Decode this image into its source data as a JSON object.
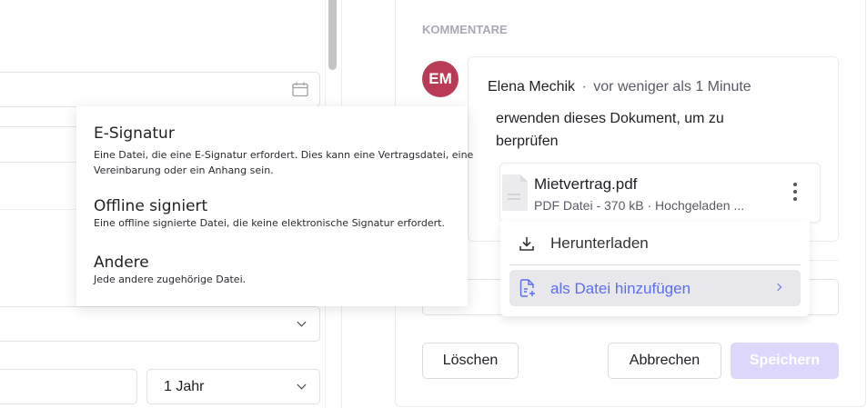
{
  "form": {
    "duration_select": "1 Jahr"
  },
  "type_dropdown": {
    "items": [
      {
        "title": "E-Signatur",
        "description": "Eine Datei, die eine E-Signatur erfordert. Dies kann eine Vertragsdatei, eine Vereinbarung oder ein Anhang sein."
      },
      {
        "title": "Offline signiert",
        "description": "Eine offline signierte Datei, die keine elektronische Signatur erfordert."
      },
      {
        "title": "Andere",
        "description": "Jede andere zugehörige Datei."
      }
    ]
  },
  "comments": {
    "heading": "KOMMENTARE",
    "avatar_initials": "EM",
    "avatar_color": "#b83c56",
    "author": "Elena Mechik",
    "separator": "·",
    "time": "vor weniger als 1 Minute",
    "text_line1": "erwenden dieses Dokument, um zu",
    "text_line2": "berprüfen",
    "attachment": {
      "name": "Mietvertrag.pdf",
      "meta": "PDF Datei - 370 kB · Hochgeladen ..."
    }
  },
  "attachment_menu": {
    "items": [
      {
        "label": "Herunterladen",
        "icon": "download-icon"
      },
      {
        "label": "als Datei hinzufügen",
        "icon": "file-plus-icon",
        "highlighted": true
      }
    ],
    "accent": "#5b6ef0"
  },
  "actions": {
    "delete": "Löschen",
    "cancel": "Abbrechen",
    "save": "Speichern",
    "save_color": "#ddd7fb"
  }
}
